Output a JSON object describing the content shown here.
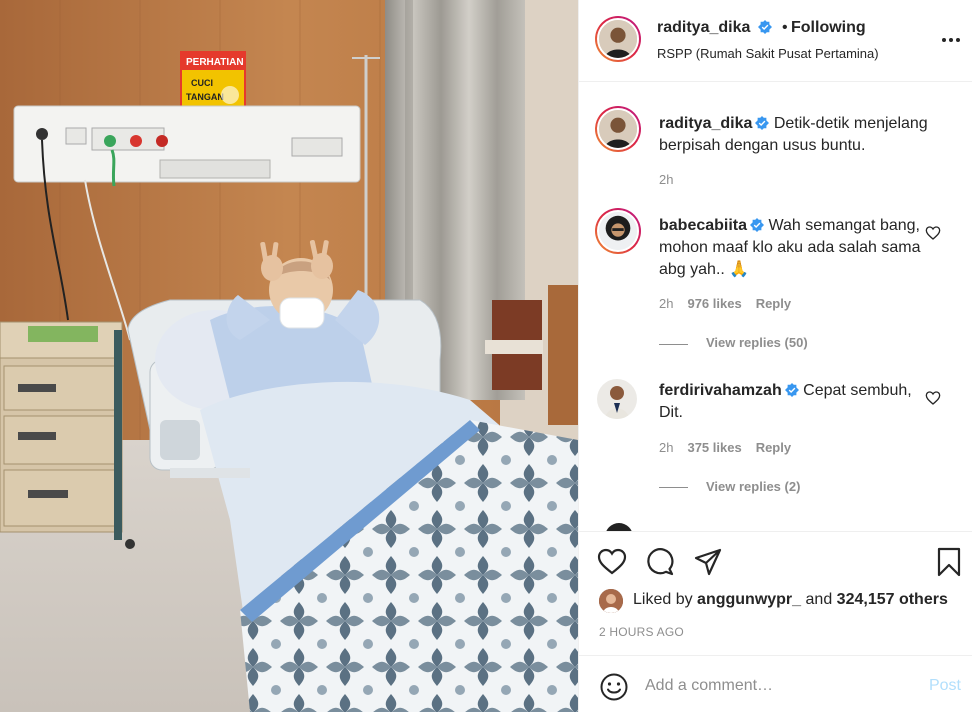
{
  "photo": {
    "sign_title": "PERHATIAN",
    "sign_line1": "CUCI",
    "sign_line2": "TANGAN"
  },
  "header": {
    "username": "raditya_dika",
    "separator": "•",
    "follow_state": "Following",
    "location": "RSPP (Rumah Sakit Pusat Pertamina)"
  },
  "caption": {
    "username": "raditya_dika",
    "text": "Detik-detik menjelang berpisah dengan usus buntu.",
    "time": "2h"
  },
  "comments": [
    {
      "username": "babecabiita",
      "text": "Wah semangat bang, mohon maaf klo aku ada salah sama abg yah.. 🙏",
      "time": "2h",
      "likes": "976 likes",
      "reply": "Reply",
      "view_replies": "View replies (50)"
    },
    {
      "username": "ferdirivahamzah",
      "text": "Cepat sembuh, Dit.",
      "time": "2h",
      "likes": "375 likes",
      "reply": "Reply",
      "view_replies": "View replies (2)"
    }
  ],
  "actions": {
    "liked_prefix": "Liked by",
    "liked_user": "anggunwypr_",
    "liked_and": "and",
    "liked_count": "324,157 others",
    "time_ago": "2 HOURS AGO"
  },
  "add_comment": {
    "placeholder": "Add a comment…",
    "post_label": "Post"
  },
  "colors": {
    "verified": "#3897f0",
    "muted": "#8e8e8e",
    "post_disabled": "#b2dffc",
    "border": "#efefef"
  }
}
